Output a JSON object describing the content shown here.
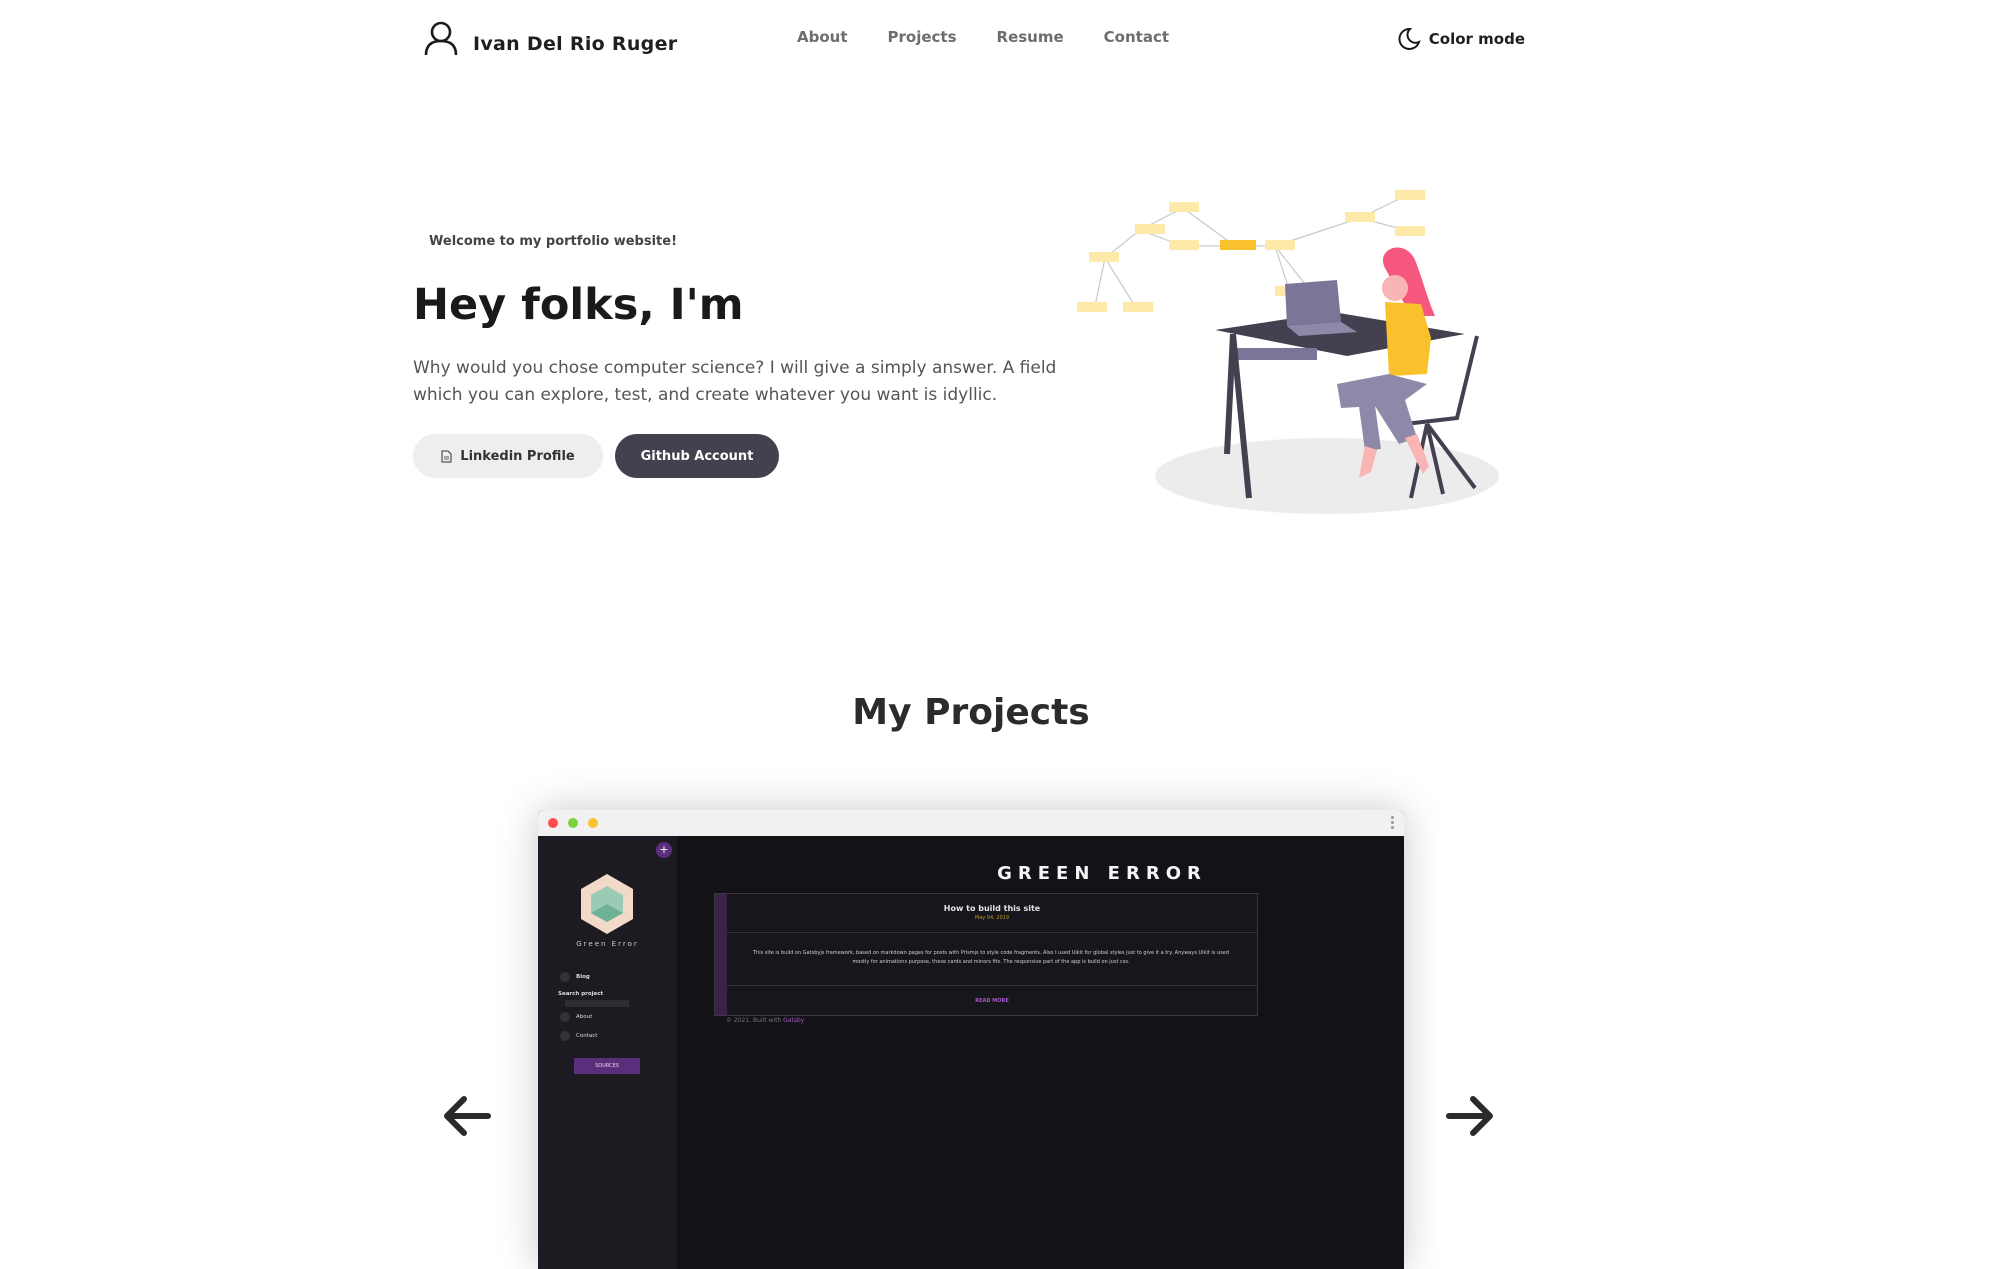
{
  "header": {
    "brand_name": "Ivan Del Rio Ruger",
    "nav": [
      "About",
      "Projects",
      "Resume",
      "Contact"
    ],
    "color_mode_label": "Color mode"
  },
  "hero": {
    "welcome": "Welcome to my portfolio website!",
    "title": "Hey folks, I'm",
    "text": "Why would you chose computer science? I will give a simply answer. A field which you can explore, test, and create whatever you want is idyllic.",
    "linkedin_label": "Linkedin Profile",
    "github_label": "Github Account"
  },
  "projects": {
    "title": "My Projects",
    "screenshot": {
      "site_title": "GREEN ERROR",
      "brand": "Green Error",
      "sidebar": {
        "blog": "Blog",
        "search_label": "Search project",
        "about": "About",
        "contact": "Contact",
        "sources": "SOURCES"
      },
      "post": {
        "title": "How to build this site",
        "date": "May 04, 2019",
        "body": "This site is build on Gatsbyjs framework, based on markdown pages for posts with Prismjs to style code fragments. Also I used Uikit for global styles just to give it a try. Anyways Uikit is used mostly for animations purpose, these cards and minors fits. The responsive part of the app is build on just css.",
        "read_more": "READ MORE"
      },
      "footer_prefix": "© 2021, Built with",
      "footer_link": "Gatsby"
    }
  },
  "colors": {
    "primary_dark": "#45404f",
    "accent_yellow": "#f9c12b",
    "note_yellow": "#fde9a9",
    "purple": "#5a2e7a"
  },
  "icons": [
    "user-icon",
    "moon-icon",
    "document-icon",
    "arrow-left-icon",
    "arrow-right-icon"
  ]
}
